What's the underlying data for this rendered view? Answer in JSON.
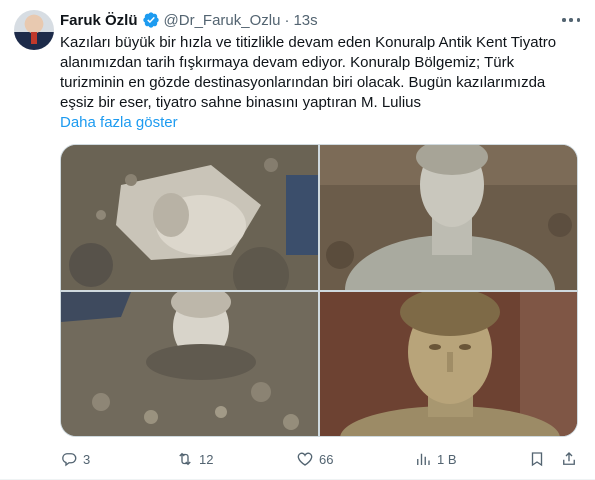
{
  "author": {
    "name": "Faruk Özlü",
    "handle": "@Dr_Faruk_Ozlu",
    "separator": "·",
    "time": "13s"
  },
  "tweet": {
    "text": "Kazıları büyük bir hızla ve titizlikle devam eden Konuralp Antik Kent Tiyatro alanımızdan tarih fışkırmaya devam ediyor. Konuralp Bölgemiz; Türk turizminin en gözde destinasyonlarından biri olacak. Bugün kazılarımızda eşsiz bir eser, tiyatro sahne binasını yaptıran M. Lulius",
    "show_more": "Daha fazla göster"
  },
  "media": [
    {
      "name": "photo-1"
    },
    {
      "name": "photo-2"
    },
    {
      "name": "photo-3"
    },
    {
      "name": "photo-4"
    }
  ],
  "actions": {
    "reply_count": "3",
    "retweet_count": "12",
    "like_count": "66",
    "views_count": "1 B"
  },
  "icons": [
    "verified-icon",
    "more-icon",
    "reply-icon",
    "retweet-icon",
    "like-icon",
    "views-icon",
    "bookmark-icon",
    "share-icon"
  ],
  "colors": {
    "accent": "#1d9bf0",
    "muted": "#536471",
    "text": "#0f1419"
  }
}
